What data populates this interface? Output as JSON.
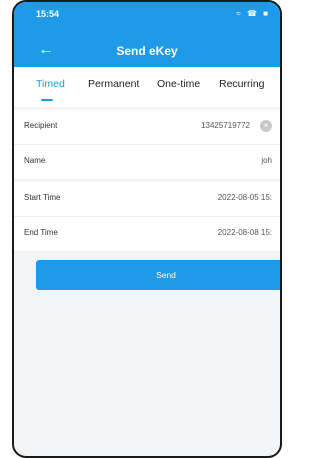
{
  "status_bar": {
    "time": "15:54",
    "icons": "≈ ☎ ■"
  },
  "header": {
    "title": "Send eKey",
    "back_icon": "back-arrow-icon"
  },
  "tabs": [
    {
      "label": "Timed",
      "active": true
    },
    {
      "label": "Permanent",
      "active": false
    },
    {
      "label": "One-time",
      "active": false
    },
    {
      "label": "Recurring",
      "active": false
    }
  ],
  "form": {
    "recipient": {
      "label": "Recipient",
      "value": "13425719772"
    },
    "name": {
      "label": "Name",
      "value": "joh"
    },
    "start_time": {
      "label": "Start Time",
      "value": "2022-08-05 15:"
    },
    "end_time": {
      "label": "End Time",
      "value": "2022-08-08 15:"
    }
  },
  "send_button": {
    "label": "Send"
  },
  "colors": {
    "accent": "#1e9ae8",
    "background": "#f4f5f7"
  }
}
